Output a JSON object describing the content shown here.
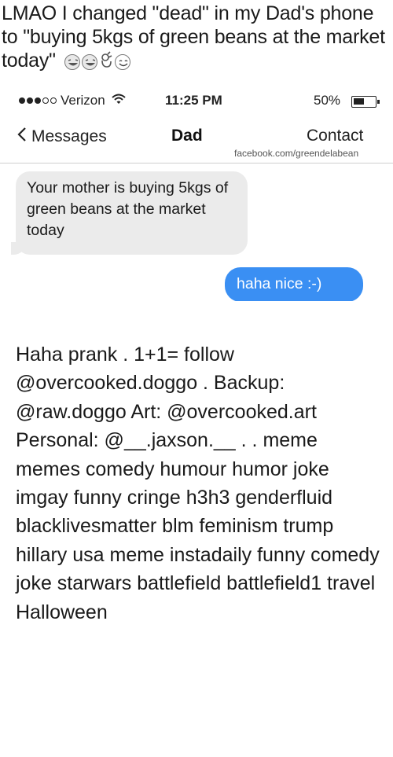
{
  "caption": {
    "text": "LMAO I changed \"dead\" in my Dad's phone to \"buying 5kgs of green beans at the market today\"",
    "emojis": [
      "laughing-face-icon",
      "laughing-face-icon",
      "ok-hand-icon",
      "smiling-face-icon"
    ]
  },
  "status_bar": {
    "carrier": "Verizon",
    "time": "11:25 PM",
    "battery": "50%",
    "battery_level": 0.5
  },
  "nav": {
    "back_label": "Messages",
    "title": "Dad",
    "contact_label": "Contact",
    "watermark": "facebook.com/greendelabean"
  },
  "messages": [
    {
      "direction": "incoming",
      "text": "Your mother is buying 5kgs of green beans at the market today"
    },
    {
      "direction": "outgoing",
      "text": "haha nice :-)"
    }
  ],
  "post_text": "Haha prank . 1+1= follow @overcooked.doggo . Backup: @raw.doggo Art: @overcooked.art Personal: @__.jaxson.__ . . meme memes comedy humour humor joke imgay funny cringe h3h3 genderfluid blacklivesmatter blm feminism trump hillary usa meme instadaily funny comedy joke starwars battlefield battlefield1 travel Halloween"
}
